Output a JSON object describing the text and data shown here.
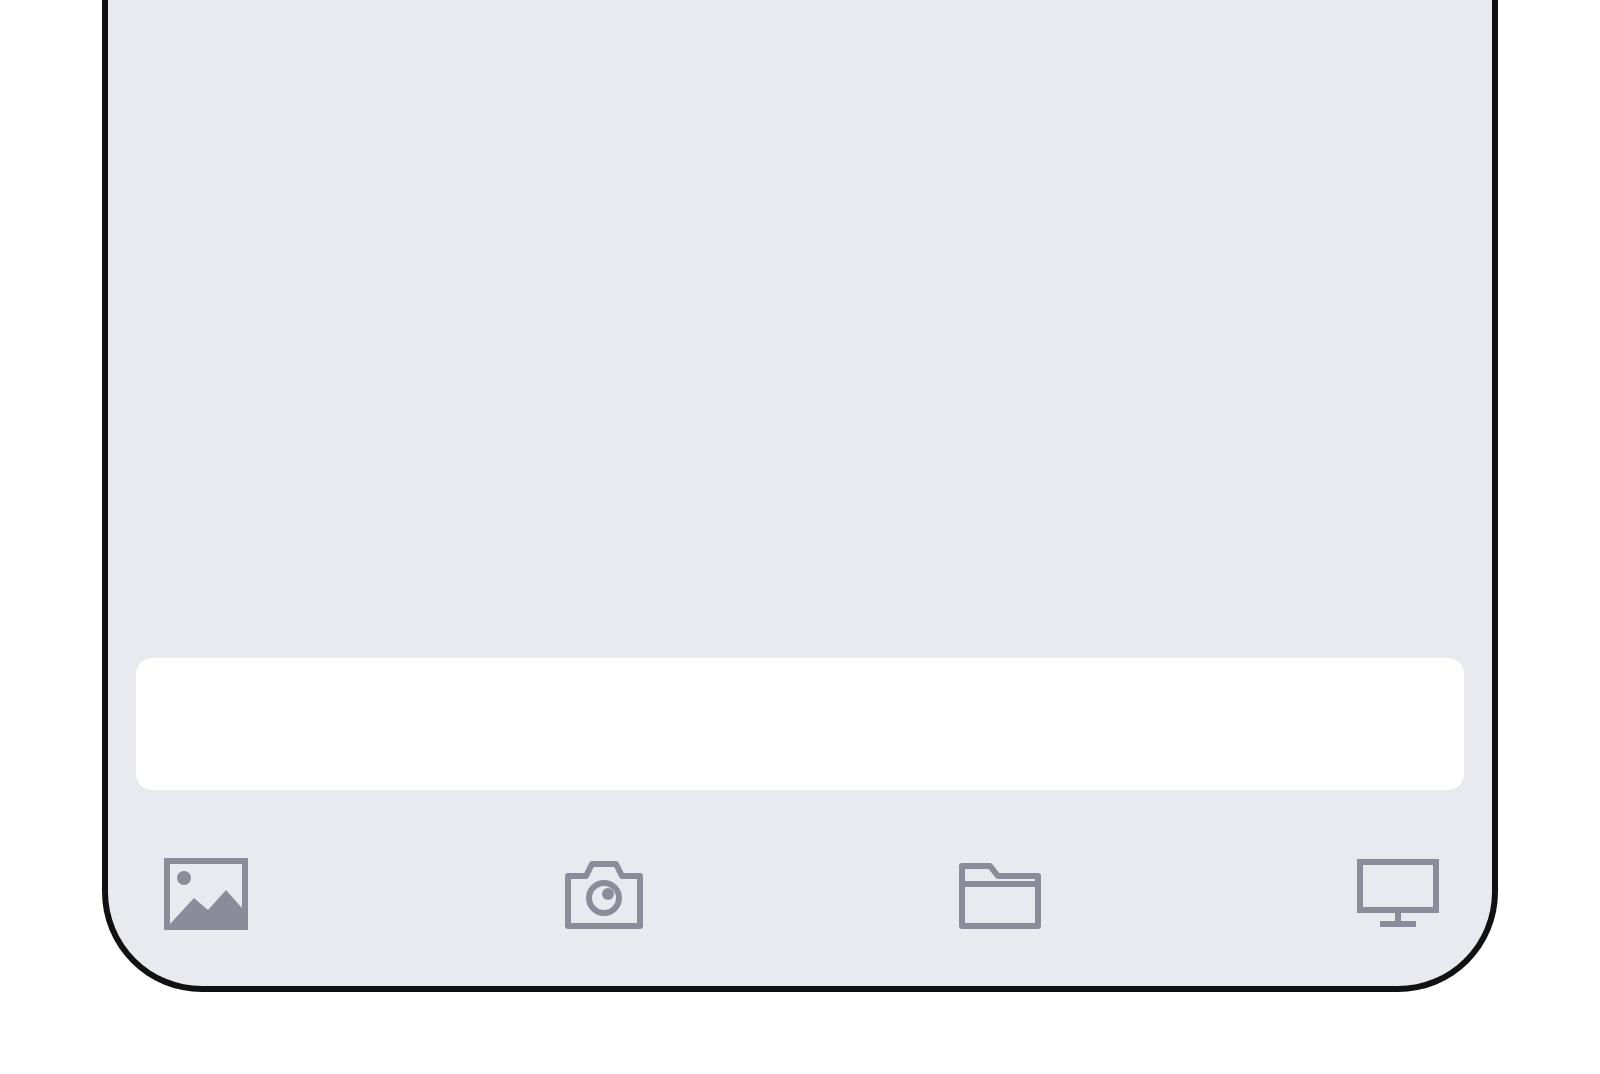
{
  "message_field": {
    "kind": "input"
  },
  "toolbar": {
    "items": [
      {
        "kind": "image"
      },
      {
        "kind": "camera"
      },
      {
        "kind": "folder"
      },
      {
        "kind": "monitor"
      }
    ]
  }
}
